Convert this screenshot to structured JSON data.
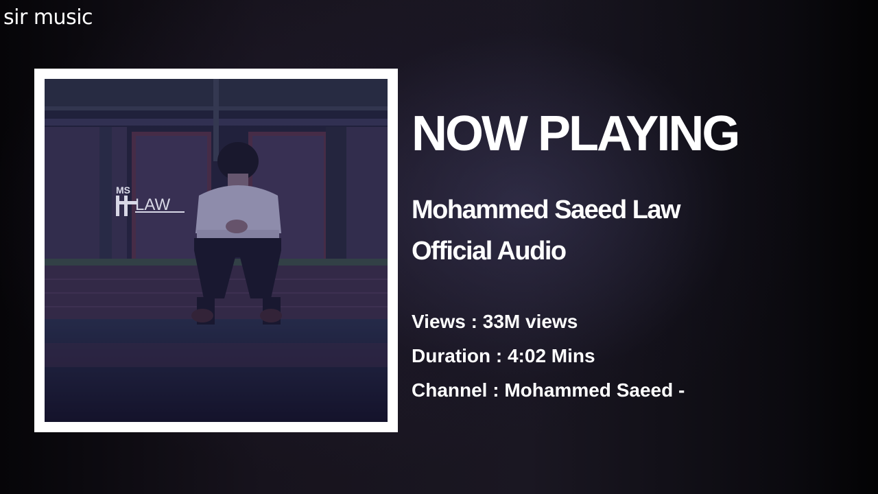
{
  "app": {
    "brand": "sir music"
  },
  "player": {
    "heading": "NOW PLAYING",
    "title_line1": "Mohammed Saeed Law",
    "title_line2": "Official Audio",
    "views": "Views : 33M views",
    "duration": "Duration : 4:02 Mins",
    "channel": "Channel : Mohammed Saeed -"
  },
  "cover": {
    "logo_text_top": "MS",
    "logo_text_main": "LAW",
    "logo_icon": "ms-law-logo-icon"
  },
  "colors": {
    "background": "#050407",
    "text": "#ffffff",
    "frame": "#ffffff",
    "cover_tint": "#2a2650"
  }
}
